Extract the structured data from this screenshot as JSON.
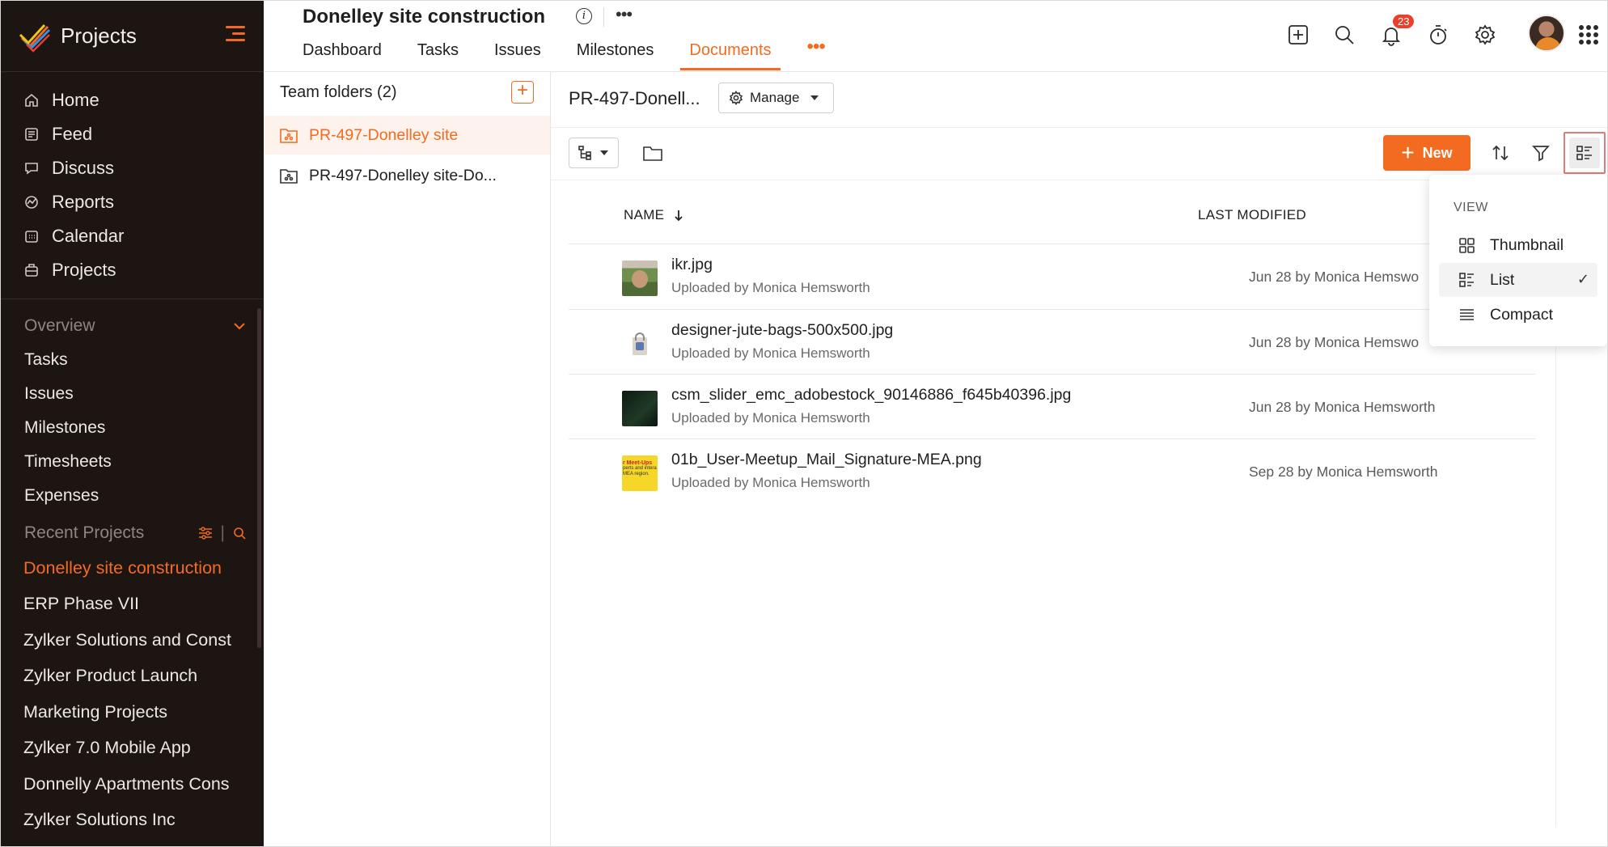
{
  "app": {
    "name": "Projects"
  },
  "sidebar": {
    "nav": [
      {
        "label": "Home",
        "icon": "home-icon"
      },
      {
        "label": "Feed",
        "icon": "feed-icon"
      },
      {
        "label": "Discuss",
        "icon": "discuss-icon"
      },
      {
        "label": "Reports",
        "icon": "reports-icon"
      },
      {
        "label": "Calendar",
        "icon": "calendar-icon"
      },
      {
        "label": "Projects",
        "icon": "projects-icon"
      }
    ],
    "overview_label": "Overview",
    "overview_items": [
      "Tasks",
      "Issues",
      "Milestones",
      "Timesheets",
      "Expenses"
    ],
    "recent_label": "Recent Projects",
    "recent_items": [
      "Donelley site construction",
      "ERP Phase VII",
      "Zylker Solutions and Const",
      "Zylker Product Launch",
      "Marketing Projects",
      "Zylker 7.0 Mobile App",
      "Donnelly Apartments Cons",
      "Zylker Solutions Inc"
    ],
    "accent": "#f26b21"
  },
  "header": {
    "project_title": "Donelley site construction",
    "tabs": [
      "Dashboard",
      "Tasks",
      "Issues",
      "Milestones",
      "Documents"
    ],
    "active_tab": "Documents",
    "more_label": "•••",
    "notification_count": "23"
  },
  "folders": {
    "heading": "Team folders (2)",
    "items": [
      "PR-497-Donelley site",
      "PR-497-Donelley site-Do..."
    ]
  },
  "main": {
    "breadcrumb": "PR-497-Donell...",
    "manage_label": "Manage",
    "new_label": "New",
    "columns": {
      "name": "NAME",
      "modified": "LAST MODIFIED"
    },
    "files": [
      {
        "name": "ikr.jpg",
        "uploaded": "Uploaded by Monica Hemsworth",
        "modified": "Jun 28 by Monica Hemswo"
      },
      {
        "name": "designer-jute-bags-500x500.jpg",
        "uploaded": "Uploaded by Monica Hemsworth",
        "modified": "Jun 28 by Monica Hemswo"
      },
      {
        "name": "csm_slider_emc_adobestock_90146886_f645b40396.jpg",
        "uploaded": "Uploaded by Monica Hemsworth",
        "modified": "Jun 28 by Monica Hemsworth"
      },
      {
        "name": "01b_User-Meetup_Mail_Signature-MEA.png",
        "uploaded": "Uploaded by Monica Hemsworth",
        "modified": "Sep 28 by Monica Hemsworth"
      }
    ]
  },
  "view_menu": {
    "heading": "VIEW",
    "options": [
      "Thumbnail",
      "List",
      "Compact"
    ],
    "selected": "List",
    "check": "✓"
  },
  "thumb_text": {
    "meetup_line1": "r Meet-Ups",
    "meetup_line2": "perts and intera",
    "meetup_line3": "MEA region."
  }
}
